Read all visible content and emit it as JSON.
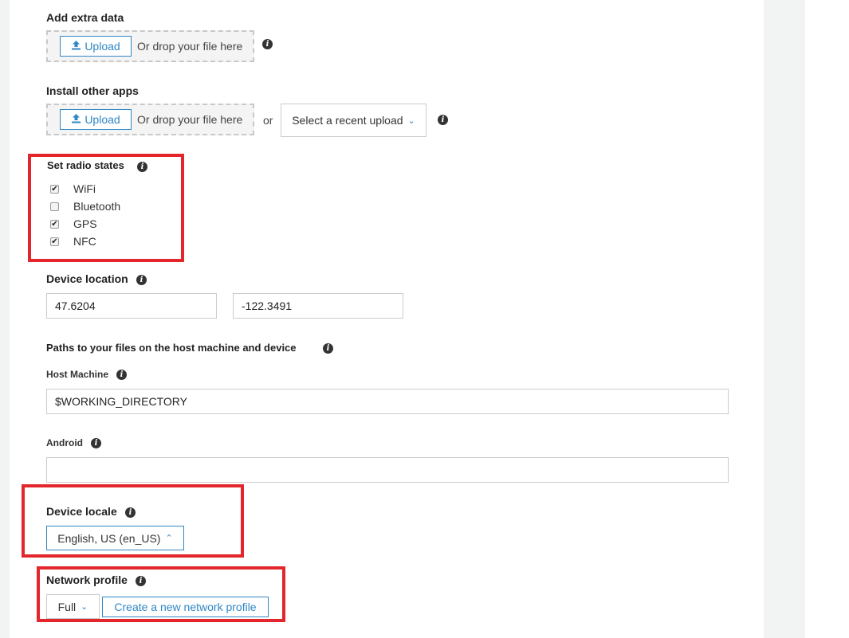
{
  "extra_data": {
    "label": "Add extra data",
    "upload_label": "Upload",
    "drop_text": "Or drop your file here"
  },
  "install_apps": {
    "label": "Install other apps",
    "upload_label": "Upload",
    "drop_text": "Or drop your file here",
    "or_text": "or",
    "recent_select": "Select a recent upload"
  },
  "radio_states": {
    "label": "Set radio states",
    "items": [
      {
        "label": "WiFi",
        "checked": true
      },
      {
        "label": "Bluetooth",
        "checked": false
      },
      {
        "label": "GPS",
        "checked": true
      },
      {
        "label": "NFC",
        "checked": true
      }
    ]
  },
  "device_location": {
    "label": "Device location",
    "latitude": "47.6204",
    "longitude": "-122.3491"
  },
  "paths": {
    "label": "Paths to your files on the host machine and device",
    "host_label": "Host Machine",
    "host_value": "$WORKING_DIRECTORY",
    "android_label": "Android",
    "android_value": ""
  },
  "device_locale": {
    "label": "Device locale",
    "value": "English, US (en_US)"
  },
  "network_profile": {
    "label": "Network profile",
    "value": "Full",
    "create_label": "Create a new network profile"
  },
  "icons": {
    "info": "info-icon",
    "upload": "upload-icon",
    "chevron_down": "chevron-down-icon",
    "chevron_up": "chevron-up-icon",
    "check": "checkmark-icon"
  },
  "colors": {
    "accent": "#2f87c5",
    "highlight": "#e3262b",
    "background": "#f2f3f3"
  }
}
